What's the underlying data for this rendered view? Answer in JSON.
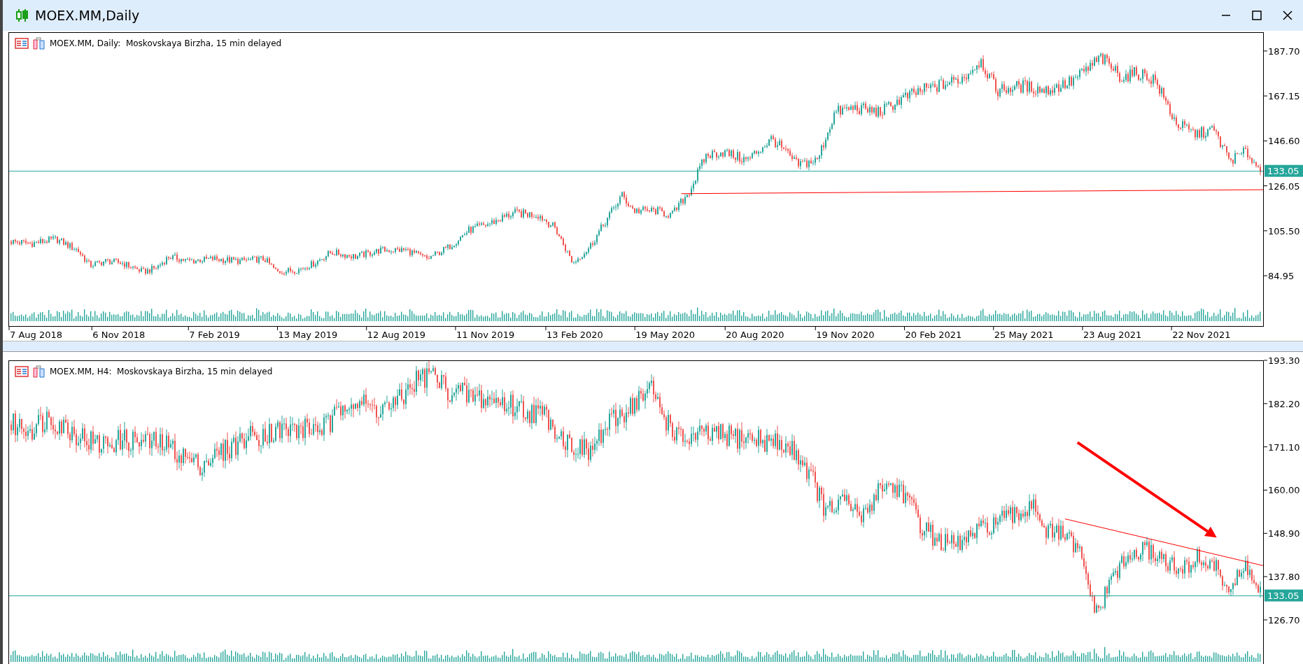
{
  "window": {
    "title": "MOEX.MM,Daily"
  },
  "charts": [
    {
      "legend": "MOEX.MM, Daily:  Moskovskaya Birzha, 15 min delayed",
      "strip": false,
      "show_dates": true,
      "price_labels": [
        "187.70",
        "167.15",
        "146.60",
        "126.05",
        "105.50",
        "84.95"
      ],
      "price_tag": "133.05",
      "date_labels": [
        "7 Aug 2018",
        "6 Nov 2018",
        "7 Feb 2019",
        "13 May 2019",
        "12 Aug 2019",
        "11 Nov 2019",
        "13 Feb 2020",
        "19 May 2020",
        "20 Aug 2020",
        "19 Nov 2020",
        "20 Feb 2021",
        "25 May 2021",
        "23 Aug 2021",
        "22 Nov 2021"
      ]
    },
    {
      "legend": "MOEX.MM, H4:  Moskovskaya Birzha, 15 min delayed",
      "strip": true,
      "show_dates": false,
      "price_labels": [
        "193.30",
        "182.20",
        "171.10",
        "160.00",
        "148.90",
        "137.80",
        "126.70"
      ],
      "price_tag": "133.05"
    }
  ]
}
